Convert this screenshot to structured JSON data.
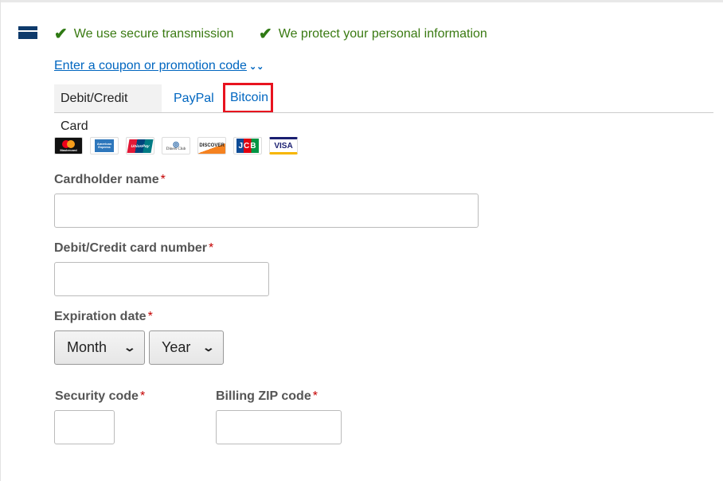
{
  "security": {
    "items": [
      "We use secure transmission",
      "We protect your personal information"
    ]
  },
  "coupon": {
    "label": "Enter a coupon or promotion code"
  },
  "tabs": [
    {
      "label": "Debit/Credit Card",
      "active": true
    },
    {
      "label": "PayPal"
    },
    {
      "label": "Bitcoin",
      "highlighted": true
    }
  ],
  "card_logos": [
    "Mastercard",
    "American Express",
    "UnionPay",
    "Diners Club",
    "Discover",
    "JCB",
    "VISA"
  ],
  "form": {
    "cardholder_label": "Cardholder name",
    "number_label": "Debit/Credit card number",
    "expiration_label": "Expiration date",
    "month": "Month",
    "year": "Year",
    "security_label": "Security code",
    "zip_label": "Billing ZIP code",
    "required_mark": "*"
  },
  "colors": {
    "link": "#0066c0",
    "check": "#2f7a14",
    "highlight": "#e8131f",
    "required": "#c40000"
  }
}
